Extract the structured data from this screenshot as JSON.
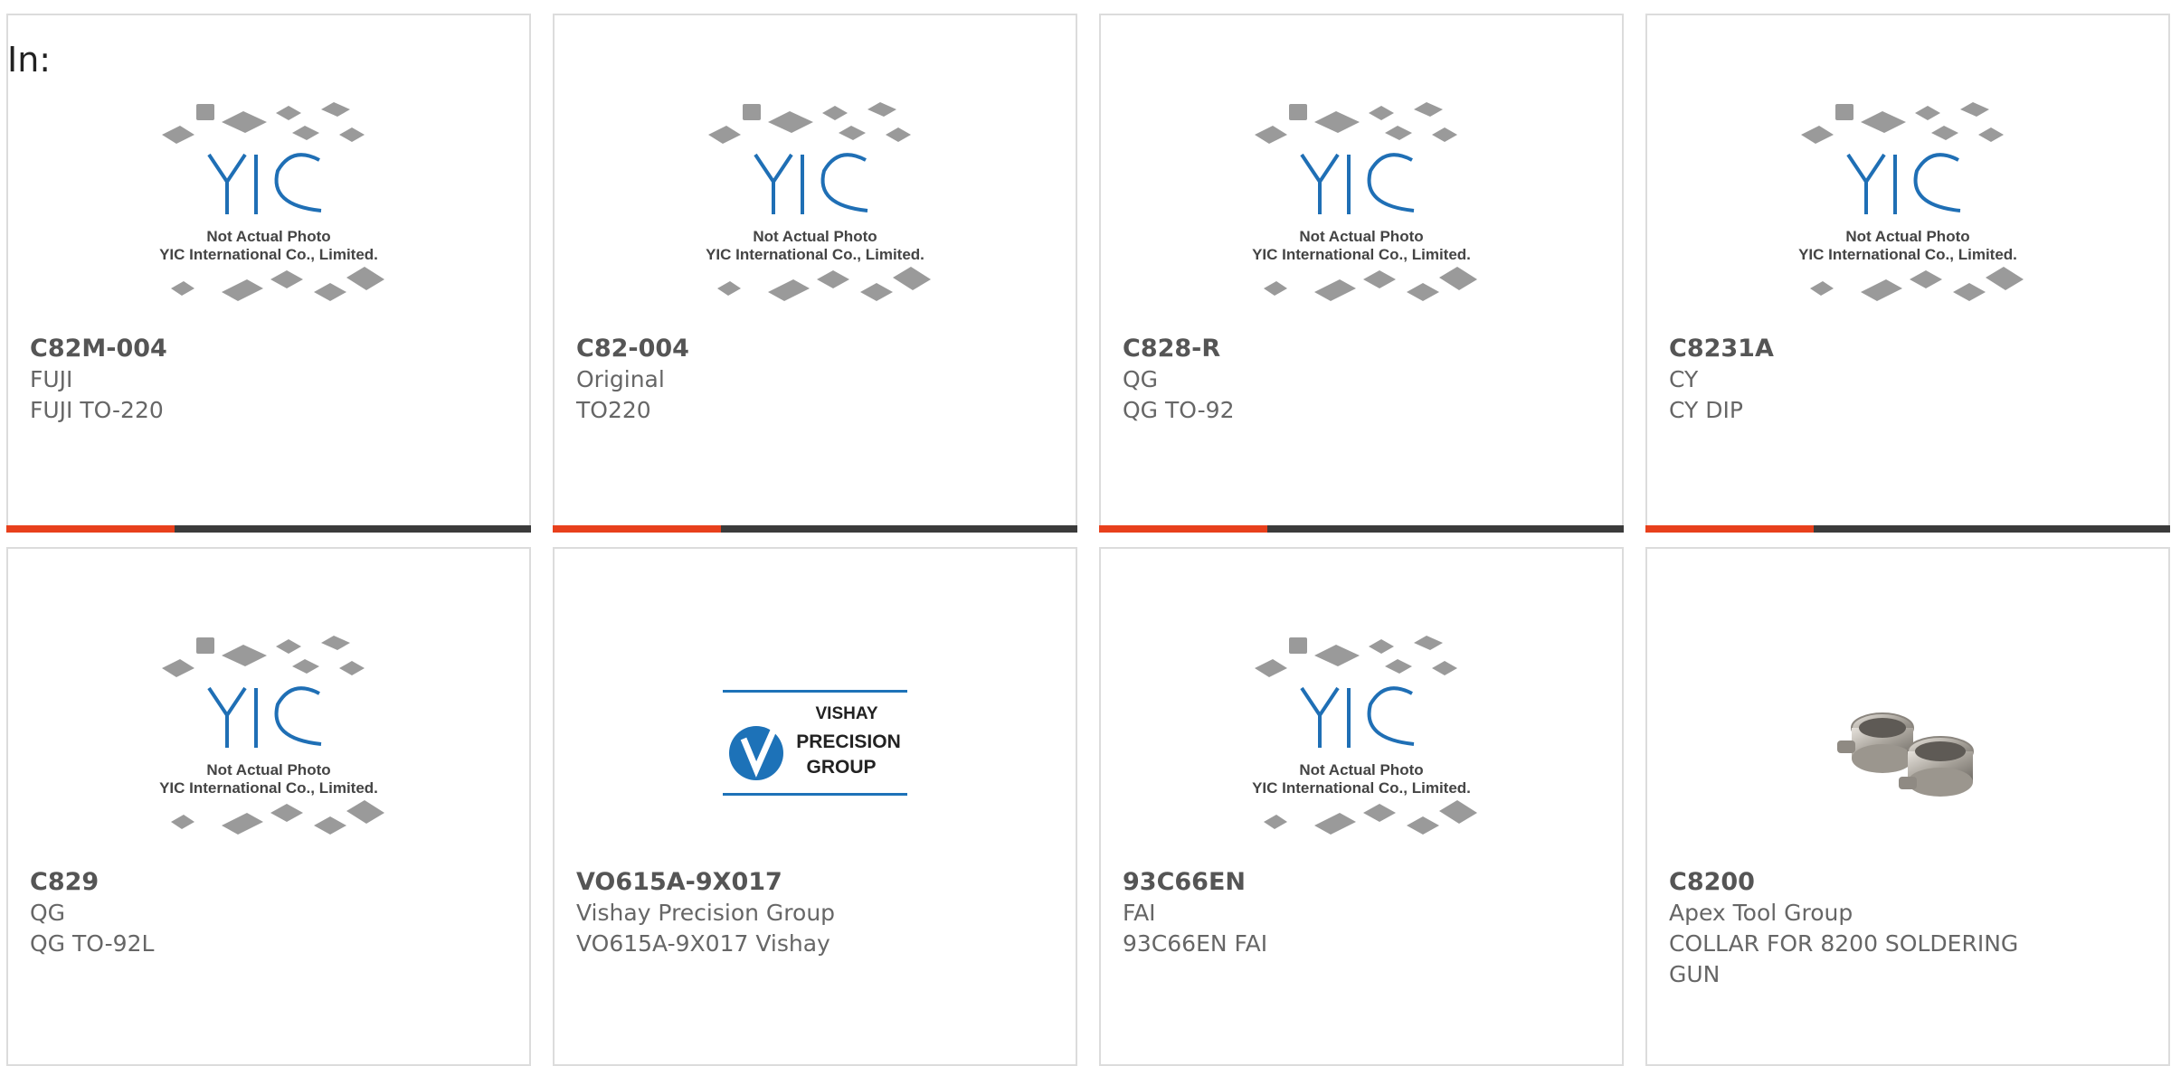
{
  "header": {
    "in_label": "In:"
  },
  "placeholder": {
    "line1": "Not Actual Photo",
    "line2": "YIC International Co., Limited."
  },
  "vishay_logo": {
    "line1": "VISHAY",
    "line2": "PRECISION",
    "line3": "GROUP"
  },
  "products": [
    {
      "part": "C82M-004",
      "brand": "FUJI",
      "desc": "FUJI TO-220",
      "image": "yic-placeholder",
      "progress": 0.32
    },
    {
      "part": "C82-004",
      "brand": "Original",
      "desc": "TO220",
      "image": "yic-placeholder",
      "progress": 0.32
    },
    {
      "part": "C828-R",
      "brand": "QG",
      "desc": "QG TO-92",
      "image": "yic-placeholder",
      "progress": 0.32
    },
    {
      "part": "C8231A",
      "brand": "CY",
      "desc": "CY DIP",
      "image": "yic-placeholder",
      "progress": 0.32
    },
    {
      "part": "C829",
      "brand": "QG",
      "desc": "QG TO-92L",
      "image": "yic-placeholder"
    },
    {
      "part": "VO615A-9X017",
      "brand": "Vishay Precision Group",
      "desc": "VO615A-9X017 Vishay",
      "image": "vishay-logo"
    },
    {
      "part": "93C66EN",
      "brand": "FAI",
      "desc": "93C66EN FAI",
      "image": "yic-placeholder"
    },
    {
      "part": "C8200",
      "brand": "Apex Tool Group",
      "desc": "COLLAR FOR 8200 SOLDERING GUN",
      "image": "collar-photo"
    }
  ],
  "colors": {
    "accent": "#e8401c",
    "bar": "#3b3b3b",
    "yic_blue": "#1f6fb5",
    "vishay_blue": "#1d72b8"
  }
}
